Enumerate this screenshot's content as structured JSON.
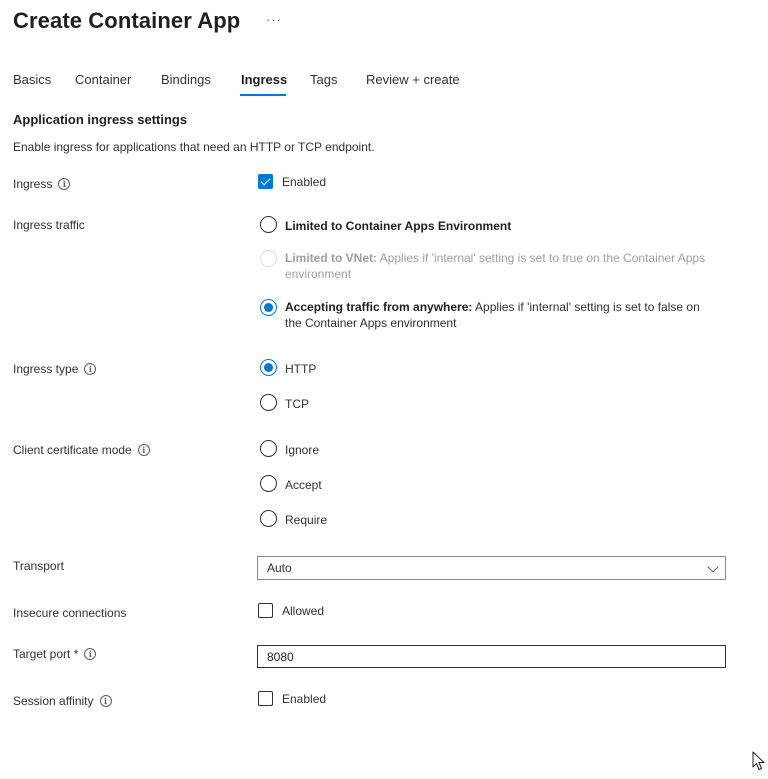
{
  "header": {
    "title": "Create Container App",
    "more": "···"
  },
  "tabs": [
    {
      "label": "Basics"
    },
    {
      "label": "Container"
    },
    {
      "label": "Bindings"
    },
    {
      "label": "Ingress",
      "active": true
    },
    {
      "label": "Tags"
    },
    {
      "label": "Review + create"
    }
  ],
  "section": {
    "title": "Application ingress settings",
    "description": "Enable ingress for applications that need an HTTP or TCP endpoint."
  },
  "fields": {
    "ingress": {
      "label": "Ingress",
      "checkbox_label": "Enabled",
      "checked": true
    },
    "ingress_traffic": {
      "label": "Ingress traffic",
      "options": [
        {
          "title": "Limited to Container Apps Environment",
          "detail": "",
          "selected": false,
          "disabled": false
        },
        {
          "title": "Limited to VNet:",
          "detail": "Applies if 'internal' setting is set to true on the Container Apps environment",
          "selected": false,
          "disabled": true
        },
        {
          "title": "Accepting traffic from anywhere:",
          "detail": "Applies if 'internal' setting is set to false on the Container Apps environment",
          "selected": true,
          "disabled": false
        }
      ]
    },
    "ingress_type": {
      "label": "Ingress type",
      "options": [
        {
          "label": "HTTP",
          "selected": true
        },
        {
          "label": "TCP",
          "selected": false
        }
      ]
    },
    "client_certificate_mode": {
      "label": "Client certificate mode",
      "options": [
        {
          "label": "Ignore",
          "selected": false
        },
        {
          "label": "Accept",
          "selected": false
        },
        {
          "label": "Require",
          "selected": false
        }
      ]
    },
    "transport": {
      "label": "Transport",
      "value": "Auto"
    },
    "insecure_connections": {
      "label": "Insecure connections",
      "checkbox_label": "Allowed",
      "checked": false
    },
    "target_port": {
      "label": "Target port *",
      "value": "8080"
    },
    "session_affinity": {
      "label": "Session affinity",
      "checkbox_label": "Enabled",
      "checked": false
    }
  },
  "colors": {
    "accent": "#0078d4",
    "text": "#323130",
    "disabled": "#a19f9d"
  },
  "icons": {
    "info": "info-icon",
    "chevron": "chevron-down-icon",
    "cursor": "mouse-pointer-icon"
  }
}
